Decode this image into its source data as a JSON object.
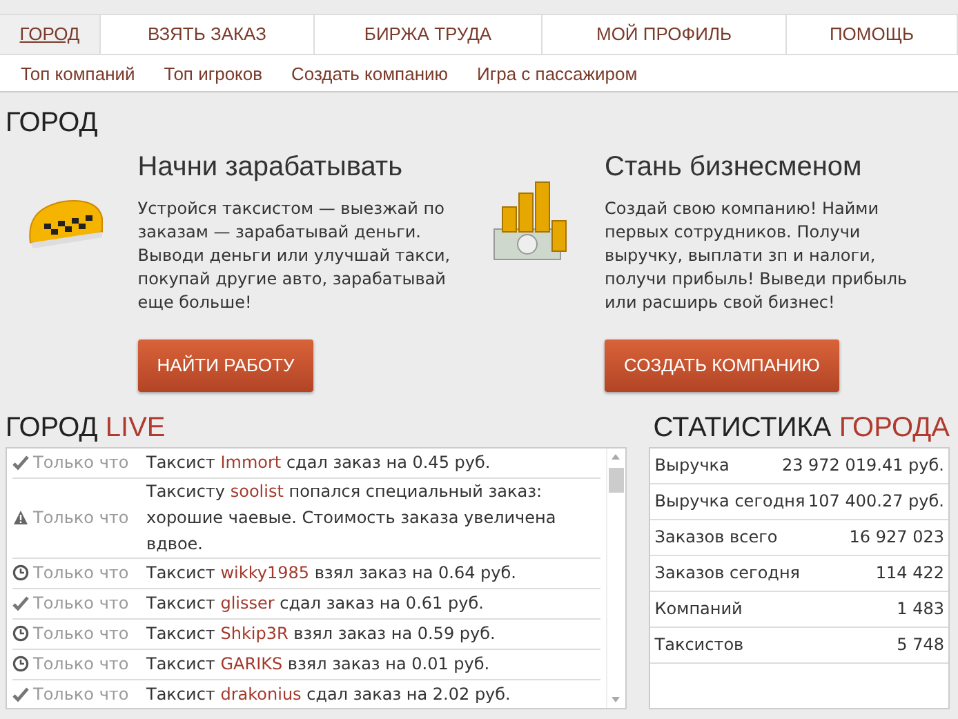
{
  "tabs": [
    {
      "label": "ГОРОД",
      "selected": true
    },
    {
      "label": "ВЗЯТЬ ЗАКАЗ",
      "selected": false
    },
    {
      "label": "БИРЖА ТРУДА",
      "selected": false
    },
    {
      "label": "МОЙ ПРОФИЛЬ",
      "selected": false
    },
    {
      "label": "ПОМОЩЬ",
      "selected": false
    }
  ],
  "subnav": [
    "Топ компаний",
    "Топ игроков",
    "Создать компанию",
    "Игра с пассажиром"
  ],
  "page_title": "ГОРОД",
  "promos": [
    {
      "kind": "taxi",
      "title": "Начни зарабатывать",
      "text": "Устройся таксистом — выезжай по заказам — зарабатывай деньги. Выводи деньги или улучшай такси, покупай другие авто, зарабатывай еще больше!",
      "button": "НАЙТИ РАБОТУ"
    },
    {
      "kind": "coins",
      "title": "Стань бизнесменом",
      "text": "Создай свою компанию! Найми первых сотрудников. Получи выручку, выплати зп и налоги, получи прибыль! Выведи прибыль или расширь свой бизнес!",
      "button": "СОЗДАТЬ КОМПАНИЮ"
    }
  ],
  "live": {
    "title": "ГОРОД",
    "title_accent": "LIVE",
    "items": [
      {
        "kind": "done",
        "time": "Только что",
        "before": "Таксист",
        "name": "Immort",
        "after": "сдал заказ на 0.45 руб."
      },
      {
        "kind": "warning",
        "time": "Только что",
        "before": "Таксисту",
        "name": "soolist",
        "after": "попался специальный заказ: хорошие чаевые. Стоимость заказа увеличена вдвое."
      },
      {
        "kind": "taken",
        "time": "Только что",
        "before": "Таксист",
        "name": "wikky1985",
        "after": "взял заказ на 0.64 руб."
      },
      {
        "kind": "done",
        "time": "Только что",
        "before": "Таксист",
        "name": "glisser",
        "after": "сдал заказ на 0.61 руб."
      },
      {
        "kind": "taken",
        "time": "Только что",
        "before": "Таксист",
        "name": "Shkip3R",
        "after": "взял заказ на 0.59 руб."
      },
      {
        "kind": "taken",
        "time": "Только что",
        "before": "Таксист",
        "name": "GARIKS",
        "after": "взял заказ на 0.01 руб."
      },
      {
        "kind": "done",
        "time": "Только что",
        "before": "Таксист",
        "name": "drakonius",
        "after": "сдал заказ на 2.02 руб."
      }
    ]
  },
  "stats": {
    "title": "СТАТИСТИКА",
    "title_accent": "ГОРОДА",
    "rows": [
      {
        "label": "Выручка",
        "value": "23 972 019.41 руб."
      },
      {
        "label": "Выручка сегодня",
        "value": "107 400.27 руб."
      },
      {
        "label": "Заказов всего",
        "value": "16 927 023"
      },
      {
        "label": "Заказов сегодня",
        "value": "114 422"
      },
      {
        "label": "Компаний",
        "value": "1 483"
      },
      {
        "label": "Таксистов",
        "value": "5 748"
      }
    ]
  }
}
